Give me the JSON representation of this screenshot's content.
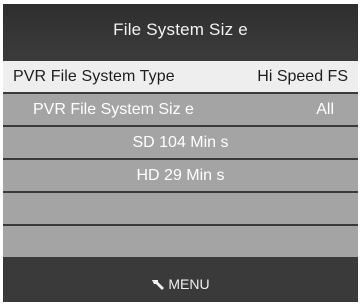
{
  "title": "File System Siz e",
  "rows": [
    {
      "label": "PVR File  System Type",
      "value": "Hi Speed FS",
      "selected": true
    },
    {
      "label": "PVR File  System Siz e",
      "value": "All"
    },
    {
      "label": "SD  104  Min s"
    },
    {
      "label": "HD   29   Min s"
    },
    {
      "label": ""
    },
    {
      "label": ""
    }
  ],
  "footer": {
    "icon": "menu-key-icon",
    "label": "MENU"
  },
  "colors": {
    "panel": "#3a3a3a",
    "row": "#a4a4a4",
    "selected_row": "#eeeeee",
    "text_light": "#ffffff",
    "text_dark": "#1e1e1e"
  }
}
